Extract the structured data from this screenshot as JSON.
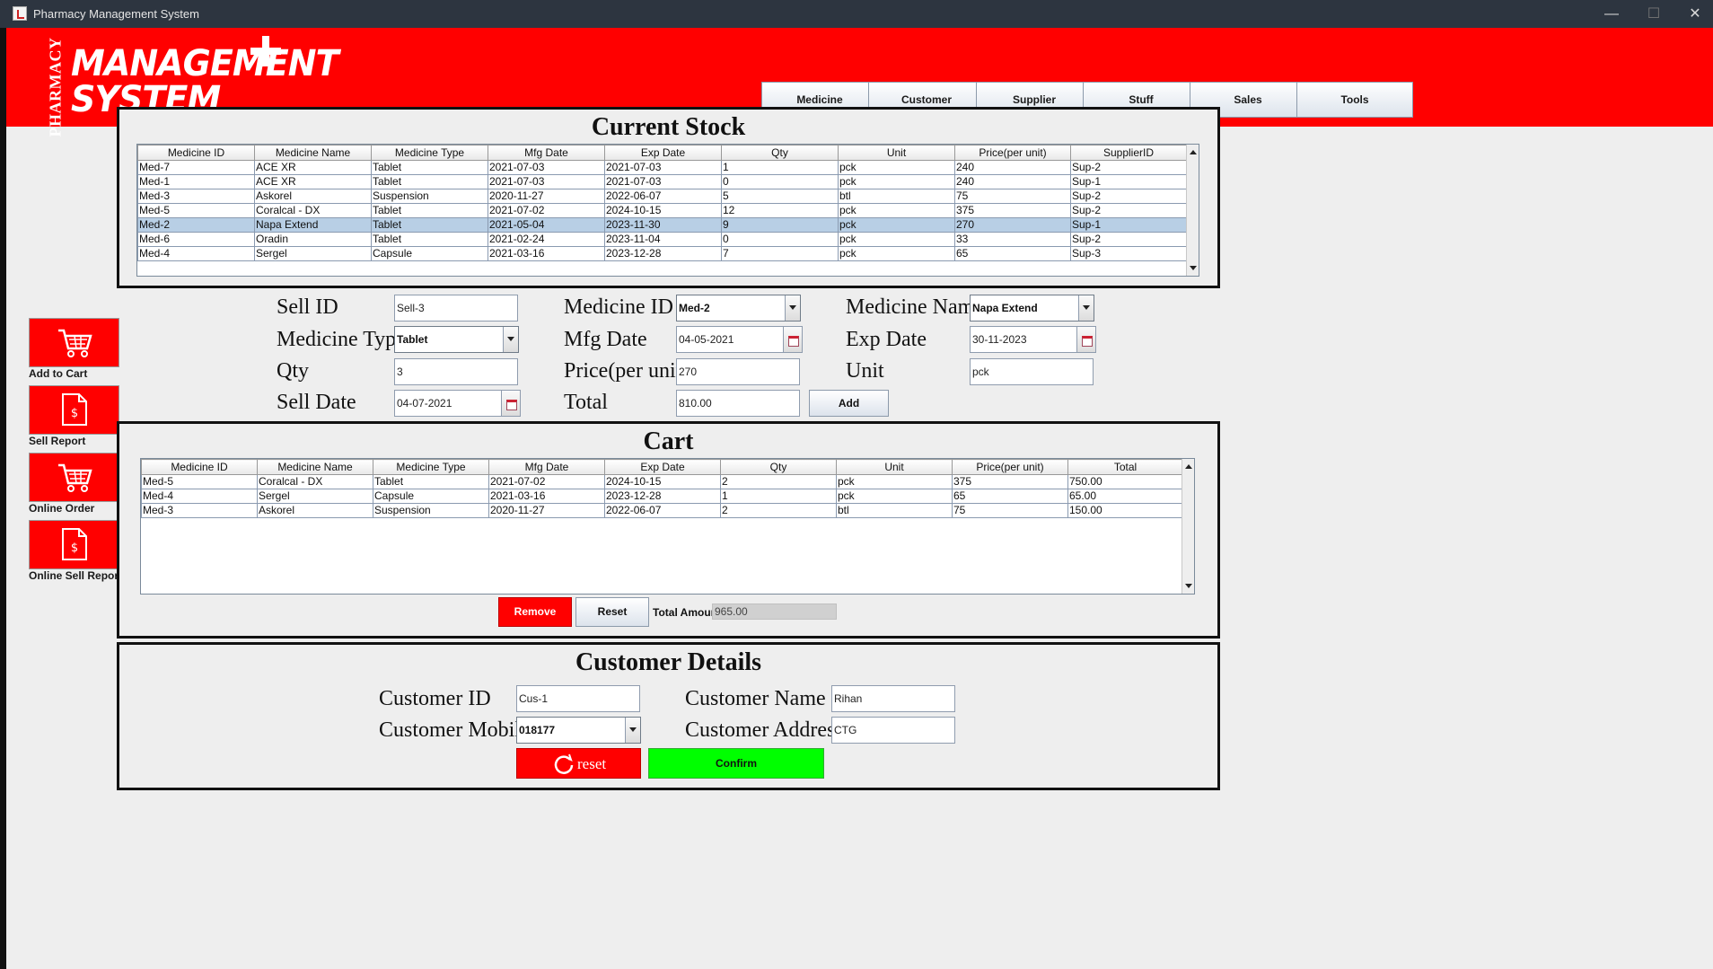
{
  "window": {
    "title": "Pharmacy Management System",
    "min": "—",
    "max": "☐",
    "close": "✕"
  },
  "logo": {
    "vertical": "PHARMACY",
    "line1": "MANAGEMENT",
    "line2": "SYSTEM"
  },
  "nav": [
    "Medicine",
    "Customer",
    "Supplier",
    "Stuff",
    "Sales",
    "Tools"
  ],
  "sidebar": [
    {
      "label": "Add to Cart",
      "icon": "cart-icon"
    },
    {
      "label": "Sell Report",
      "icon": "dollar-document-icon"
    },
    {
      "label": "Online Order",
      "icon": "cart-icon"
    },
    {
      "label": "Online Sell Report",
      "icon": "dollar-document-icon"
    }
  ],
  "stock": {
    "title": "Current Stock",
    "columns": [
      "Medicine ID",
      "Medicine Name",
      "Medicine Type",
      "Mfg Date",
      "Exp Date",
      "Qty",
      "Unit",
      "Price(per unit)",
      "SupplierID"
    ],
    "rows": [
      [
        "Med-7",
        "ACE XR",
        "Tablet",
        "2021-07-03",
        "2021-07-03",
        "1",
        "pck",
        "240",
        "Sup-2"
      ],
      [
        "Med-1",
        "ACE XR",
        "Tablet",
        "2021-07-03",
        "2021-07-03",
        "0",
        "pck",
        "240",
        "Sup-1"
      ],
      [
        "Med-3",
        "Askorel",
        "Suspension",
        "2020-11-27",
        "2022-06-07",
        "5",
        "btl",
        "75",
        "Sup-2"
      ],
      [
        "Med-5",
        "Coralcal - DX",
        "Tablet",
        "2021-07-02",
        "2024-10-15",
        "12",
        "pck",
        "375",
        "Sup-2"
      ],
      [
        "Med-2",
        "Napa Extend",
        "Tablet",
        "2021-05-04",
        "2023-11-30",
        "9",
        "pck",
        "270",
        "Sup-1"
      ],
      [
        "Med-6",
        "Oradin",
        "Tablet",
        "2021-02-24",
        "2023-11-04",
        "0",
        "pck",
        "33",
        "Sup-2"
      ],
      [
        "Med-4",
        "Sergel",
        "Capsule",
        "2021-03-16",
        "2023-12-28",
        "7",
        "pck",
        "65",
        "Sup-3"
      ]
    ],
    "selected_row": 4
  },
  "form": {
    "sell_id_label": "Sell ID",
    "sell_id": "Sell-3",
    "medicine_id_label": "Medicine ID",
    "medicine_id": "Med-2",
    "medicine_name_label": "Medicine Name",
    "medicine_name": "Napa Extend",
    "medicine_type_label": "Medicine Type",
    "medicine_type": "Tablet",
    "mfg_date_label": "Mfg Date",
    "mfg_date": "04-05-2021",
    "exp_date_label": "Exp Date",
    "exp_date": "30-11-2023",
    "qty_label": "Qty",
    "qty": "3",
    "price_label": "Price(per unit)",
    "price": "270",
    "unit_label": "Unit",
    "unit": "pck",
    "sell_date_label": "Sell Date",
    "sell_date": "04-07-2021",
    "total_label": "Total",
    "total": "810.00",
    "add_label": "Add"
  },
  "cart": {
    "title": "Cart",
    "columns": [
      "Medicine ID",
      "Medicine Name",
      "Medicine Type",
      "Mfg Date",
      "Exp Date",
      "Qty",
      "Unit",
      "Price(per unit)",
      "Total"
    ],
    "rows": [
      [
        "Med-5",
        "Coralcal - DX",
        "Tablet",
        "2021-07-02",
        "2024-10-15",
        "2",
        "pck",
        "375",
        "750.00"
      ],
      [
        "Med-4",
        "Sergel",
        "Capsule",
        "2021-03-16",
        "2023-12-28",
        "1",
        "pck",
        "65",
        "65.00"
      ],
      [
        "Med-3",
        "Askorel",
        "Suspension",
        "2020-11-27",
        "2022-06-07",
        "2",
        "btl",
        "75",
        "150.00"
      ]
    ],
    "remove_label": "Remove",
    "reset_label": "Reset",
    "total_amount_label": "Total Amount",
    "total_amount": "965.00"
  },
  "customer": {
    "title": "Customer Details",
    "id_label": "Customer ID",
    "id": "Cus-1",
    "name_label": "Customer Name",
    "name": "Rihan",
    "mobile_label": "Customer Mobile",
    "mobile": "018177",
    "address_label": "Customer Address",
    "address": "CTG",
    "reset_label": "reset",
    "confirm_label": "Confirm"
  },
  "colors": {
    "brand_red": "#ff0000",
    "confirm_green": "#00ff00",
    "selected_row": "#b8cfe5"
  }
}
